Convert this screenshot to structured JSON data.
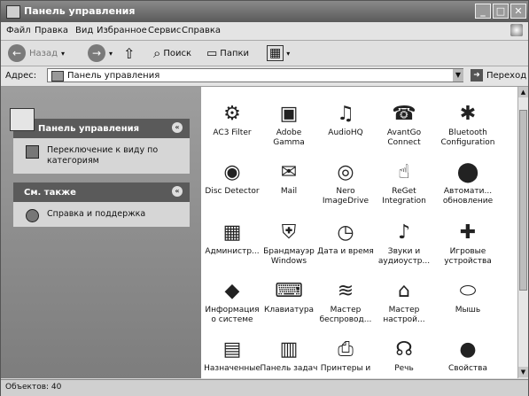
{
  "window": {
    "title": "Панель управления"
  },
  "menu": [
    "Файл",
    "Правка",
    "Вид",
    "Избранное",
    "Сервис",
    "Справка"
  ],
  "toolbar": {
    "back": "Назад",
    "search": "Поиск",
    "folders": "Папки"
  },
  "address": {
    "label": "Адрес:",
    "value": "Панель управления",
    "go": "Переход"
  },
  "sidepanel": {
    "control": {
      "title": "Панель управления",
      "link": "Переключение к виду по категориям"
    },
    "seealso": {
      "title": "См. также",
      "link": "Справка и поддержка"
    }
  },
  "items": [
    {
      "label": "AC3 Filter",
      "icon": "ac3-filter-icon",
      "glyph": "⚙"
    },
    {
      "label": "Adobe Gamma",
      "icon": "monitor-icon",
      "glyph": "▣"
    },
    {
      "label": "AudioHQ",
      "icon": "audio-icon",
      "glyph": "♫"
    },
    {
      "label": "AvantGo Connect",
      "icon": "avantgo-icon",
      "glyph": "☎"
    },
    {
      "label": "Bluetooth Configuration",
      "icon": "bluetooth-icon",
      "glyph": "✱"
    },
    {
      "label": "Disc Detector",
      "icon": "disc-icon",
      "glyph": "◉"
    },
    {
      "label": "Mail",
      "icon": "mail-icon",
      "glyph": "✉"
    },
    {
      "label": "Nero ImageDrive",
      "icon": "nero-icon",
      "glyph": "◎"
    },
    {
      "label": "ReGet Integration",
      "icon": "reget-icon",
      "glyph": "☝"
    },
    {
      "label": "Автомати... обновление",
      "icon": "update-icon",
      "glyph": "⬤"
    },
    {
      "label": "Администр...",
      "icon": "admin-icon",
      "glyph": "▦"
    },
    {
      "label": "Брандмауэр Windows",
      "icon": "firewall-icon",
      "glyph": "⛨"
    },
    {
      "label": "Дата и время",
      "icon": "clock-icon",
      "glyph": "◷"
    },
    {
      "label": "Звуки и аудиоустр...",
      "icon": "sound-icon",
      "glyph": "♪"
    },
    {
      "label": "Игровые устройства",
      "icon": "gamepad-icon",
      "glyph": "✚"
    },
    {
      "label": "Информация о системе",
      "icon": "sysinfo-icon",
      "glyph": "◆"
    },
    {
      "label": "Клавиатура",
      "icon": "keyboard-icon",
      "glyph": "⌨"
    },
    {
      "label": "Мастер беспровод...",
      "icon": "wireless-icon",
      "glyph": "≋"
    },
    {
      "label": "Мастер настрой...",
      "icon": "network-wizard-icon",
      "glyph": "⌂"
    },
    {
      "label": "Мышь",
      "icon": "mouse-icon",
      "glyph": "⬭"
    },
    {
      "label": "Назначенные",
      "icon": "scheduled-tasks-icon",
      "glyph": "▤"
    },
    {
      "label": "Панель задач",
      "icon": "taskbar-icon",
      "glyph": "▥"
    },
    {
      "label": "Принтеры и",
      "icon": "printer-icon",
      "glyph": "⎙"
    },
    {
      "label": "Речь",
      "icon": "speech-icon",
      "glyph": "☊"
    },
    {
      "label": "Свойства",
      "icon": "properties-icon",
      "glyph": "●"
    }
  ],
  "status": {
    "text": "Объектов: 40"
  }
}
